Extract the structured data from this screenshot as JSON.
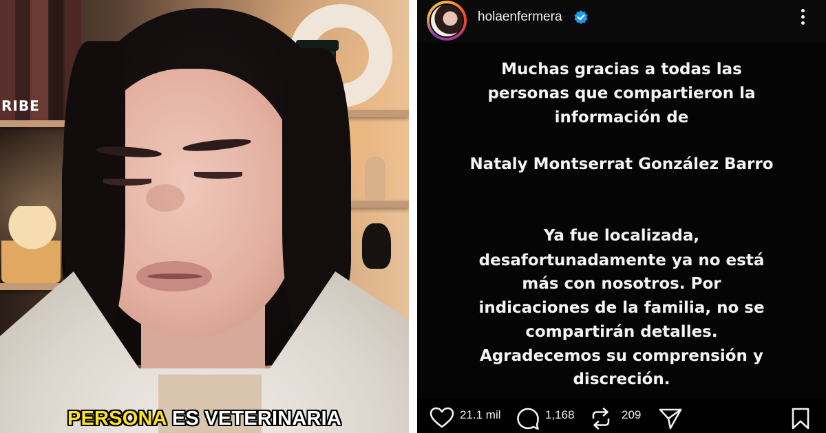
{
  "video": {
    "background_text": "RIBE",
    "caption_highlight": "PERSONA",
    "caption_rest": " ES VETERINARIA",
    "caption_highlight_color": "#ffe41c"
  },
  "story": {
    "username": "holaenfermera",
    "verified_color": "#1d9bf0",
    "lines": [
      "Muchas gracias a todas las",
      "personas que compartieron la",
      "información de",
      "Nataly Montserrat González Barro",
      "Ya fue localizada,",
      "desafortunadamente ya no está",
      "más con nosotros. Por",
      "indicaciones de la familia, no se",
      "compartirán detalles.",
      "Agradecemos su comprensión y",
      "discreción."
    ],
    "likes": "21.1 mil",
    "comments": "1,168",
    "reposts": "209",
    "icons": [
      "heart-icon",
      "comment-icon",
      "repost-icon",
      "share-icon",
      "bookmark-icon",
      "more-icon",
      "verified-icon"
    ]
  }
}
